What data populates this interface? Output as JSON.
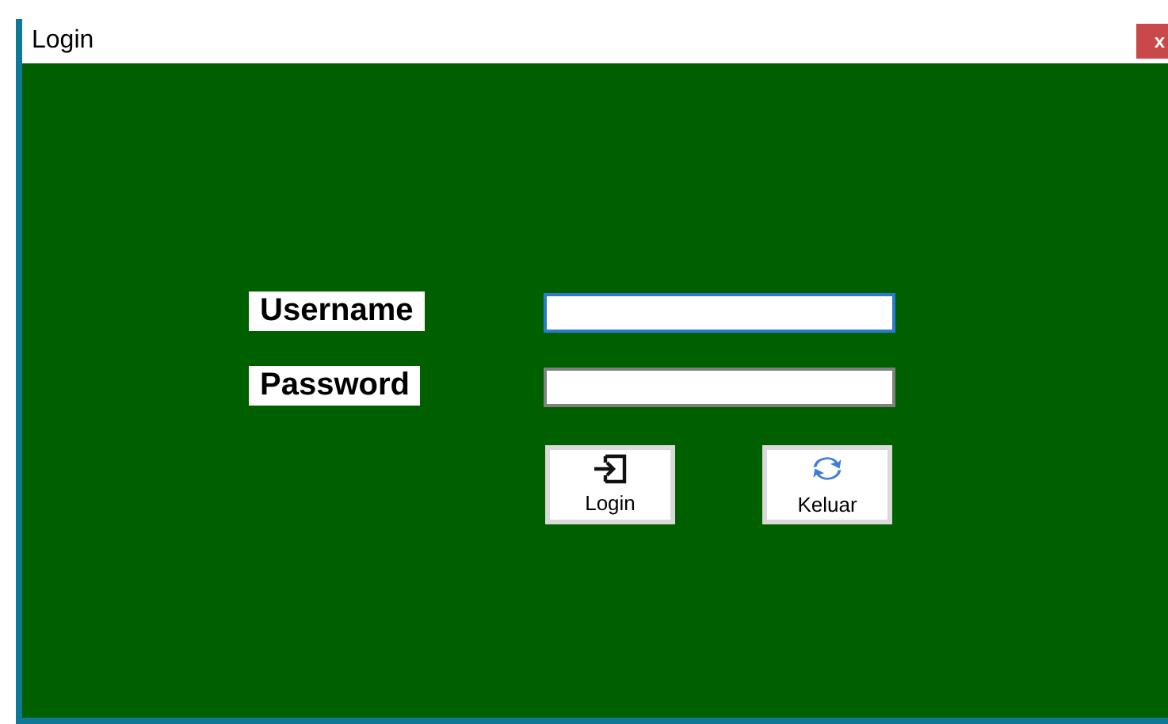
{
  "window": {
    "title": "Login",
    "close": "x"
  },
  "fields": [
    {
      "label": "Username",
      "focused": true
    },
    {
      "label": "Password",
      "focused": false
    }
  ],
  "buttons": [
    {
      "label": "Login",
      "kind": "login"
    },
    {
      "label": "Keluar",
      "kind": "refresh"
    }
  ]
}
